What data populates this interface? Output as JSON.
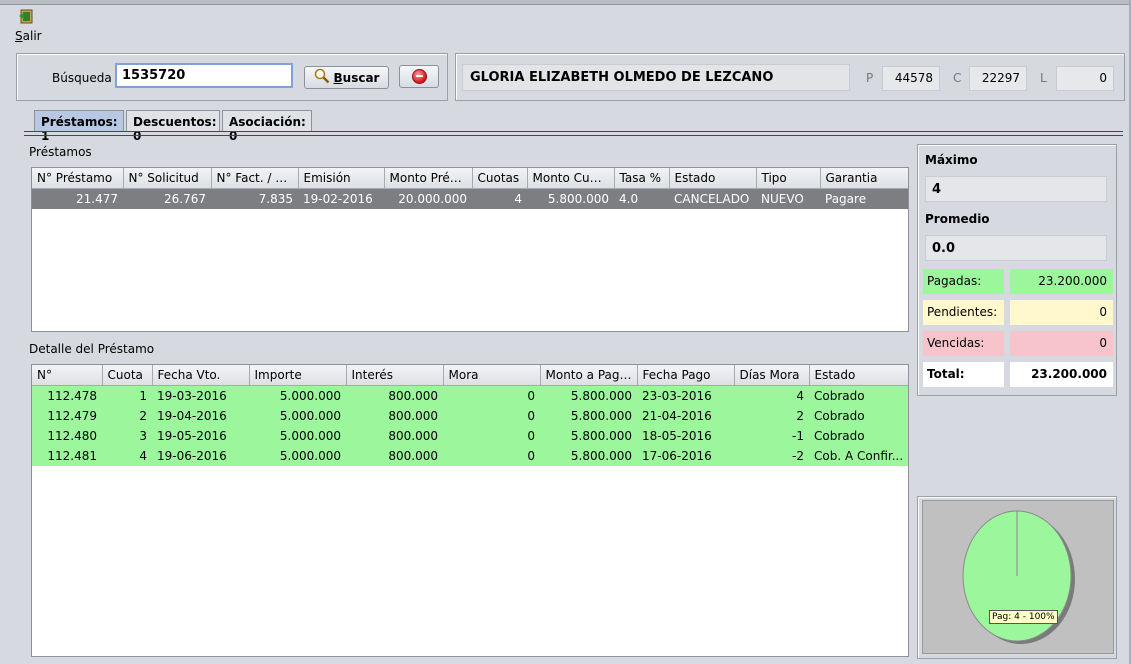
{
  "toolbar": {
    "exit_label_u": "S",
    "exit_label_rest": "alir"
  },
  "search": {
    "label": "Búsqueda",
    "value": "1535720",
    "button_label_u": "B",
    "button_label_rest": "uscar"
  },
  "person": {
    "name": "GLORIA ELIZABETH OLMEDO DE LEZCANO",
    "p_label": "P",
    "p_value": "44578",
    "c_label": "C",
    "c_value": "22297",
    "l_label": "L",
    "l_value": "0"
  },
  "tabs": [
    {
      "label": "Préstamos: 1",
      "active": true
    },
    {
      "label": "Descuentos: 0",
      "active": false
    },
    {
      "label": "Asociación: 0",
      "active": false
    }
  ],
  "loans": {
    "title": "Préstamos",
    "columns": [
      "N° Préstamo",
      "N° Solicitud",
      "N° Fact. / Op...",
      "Emisión",
      "Monto Prést...",
      "Cuotas",
      "Monto Cuotas",
      "Tasa %",
      "Estado",
      "Tipo",
      "Garantia"
    ],
    "rows": [
      [
        "21.477",
        "26.767",
        "7.835",
        "19-02-2016",
        "20.000.000",
        "4",
        "5.800.000",
        "4.0",
        "CANCELADO",
        "NUEVO",
        "Pagare"
      ]
    ]
  },
  "detail": {
    "title": "Detalle del Préstamo",
    "columns": [
      "N°",
      "Cuota",
      "Fecha Vto.",
      "Importe",
      "Interés",
      "Mora",
      "Monto a Pagar",
      "Fecha Pago",
      "Días Mora",
      "Estado"
    ],
    "rows": [
      [
        "112.478",
        "1",
        "19-03-2016",
        "5.000.000",
        "800.000",
        "0",
        "5.800.000",
        "23-03-2016",
        "4",
        "Cobrado"
      ],
      [
        "112.479",
        "2",
        "19-04-2016",
        "5.000.000",
        "800.000",
        "0",
        "5.800.000",
        "21-04-2016",
        "2",
        "Cobrado"
      ],
      [
        "112.480",
        "3",
        "19-05-2016",
        "5.000.000",
        "800.000",
        "0",
        "5.800.000",
        "18-05-2016",
        "-1",
        "Cobrado"
      ],
      [
        "112.481",
        "4",
        "19-06-2016",
        "5.000.000",
        "800.000",
        "0",
        "5.800.000",
        "17-06-2016",
        "-2",
        "Cob. A Confir..."
      ]
    ]
  },
  "summary": {
    "max_label": "Máximo",
    "max_value": "4",
    "avg_label": "Promedio",
    "avg_value": "0.0",
    "paid_label": "Pagadas:",
    "paid_value": "23.200.000",
    "pending_label": "Pendientes:",
    "pending_value": "0",
    "overdue_label": "Vencidas:",
    "overdue_value": "0",
    "total_label": "Total:",
    "total_value": "23.200.000"
  },
  "colors": {
    "paid": "#9cf79c",
    "pending": "#fff8cc",
    "overdue": "#f7c4cc",
    "selected_row": "#7c7e82",
    "active_tab": "#b8c8e2"
  },
  "chart_data": {
    "type": "pie",
    "slices": [
      {
        "label": "Pag: 4 - 100%",
        "value": 100
      }
    ]
  }
}
